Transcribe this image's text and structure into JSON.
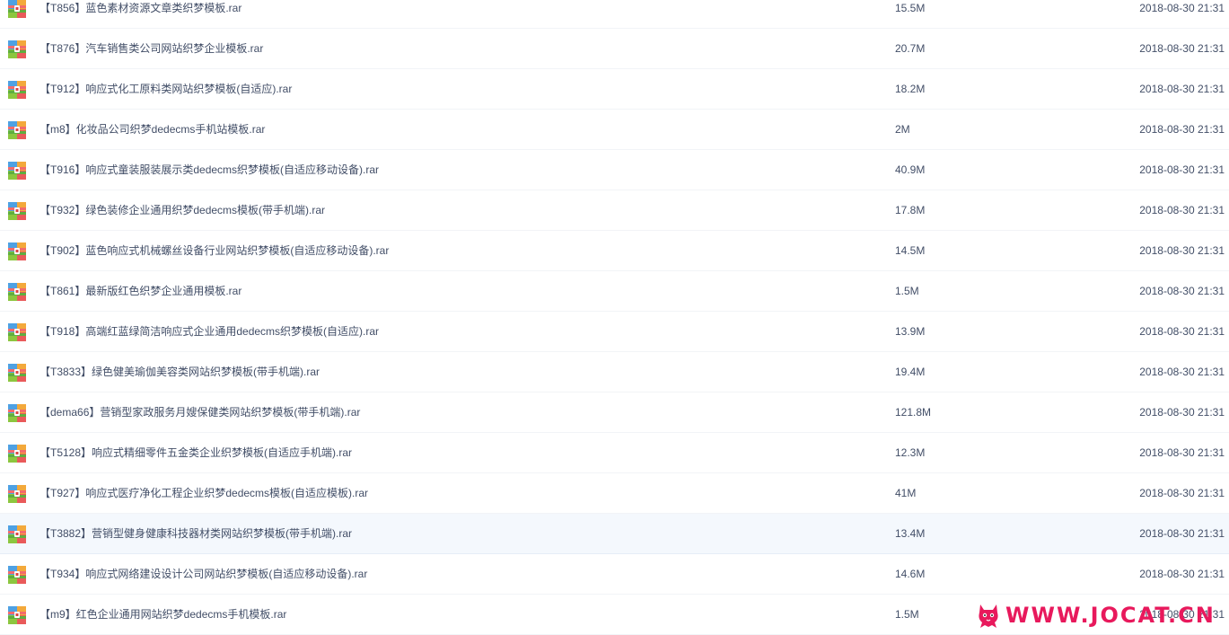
{
  "files": [
    {
      "name": "【T856】蓝色素材资源文章类织梦模板.rar",
      "size": "15.5M",
      "date": "2018-08-30 21:31"
    },
    {
      "name": "【T876】汽车销售类公司网站织梦企业模板.rar",
      "size": "20.7M",
      "date": "2018-08-30 21:31"
    },
    {
      "name": "【T912】响应式化工原料类网站织梦模板(自适应).rar",
      "size": "18.2M",
      "date": "2018-08-30 21:31"
    },
    {
      "name": "【m8】化妆品公司织梦dedecms手机站模板.rar",
      "size": "2M",
      "date": "2018-08-30 21:31"
    },
    {
      "name": "【T916】响应式童装服装展示类dedecms织梦模板(自适应移动设备).rar",
      "size": "40.9M",
      "date": "2018-08-30 21:31"
    },
    {
      "name": "【T932】绿色装修企业通用织梦dedecms模板(带手机端).rar",
      "size": "17.8M",
      "date": "2018-08-30 21:31"
    },
    {
      "name": "【T902】蓝色响应式机械螺丝设备行业网站织梦模板(自适应移动设备).rar",
      "size": "14.5M",
      "date": "2018-08-30 21:31"
    },
    {
      "name": "【T861】最新版红色织梦企业通用模板.rar",
      "size": "1.5M",
      "date": "2018-08-30 21:31"
    },
    {
      "name": "【T918】高端红蓝绿简洁响应式企业通用dedecms织梦模板(自适应).rar",
      "size": "13.9M",
      "date": "2018-08-30 21:31"
    },
    {
      "name": "【T3833】绿色健美瑜伽美容类网站织梦模板(带手机端).rar",
      "size": "19.4M",
      "date": "2018-08-30 21:31"
    },
    {
      "name": "【dema66】营销型家政服务月嫂保健类网站织梦模板(带手机端).rar",
      "size": "121.8M",
      "date": "2018-08-30 21:31"
    },
    {
      "name": "【T5128】响应式精细零件五金类企业织梦模板(自适应手机端).rar",
      "size": "12.3M",
      "date": "2018-08-30 21:31"
    },
    {
      "name": "【T927】响应式医疗净化工程企业织梦dedecms模板(自适应模板).rar",
      "size": "41M",
      "date": "2018-08-30 21:31"
    },
    {
      "name": "【T3882】营销型健身健康科技器材类网站织梦模板(带手机端).rar",
      "size": "13.4M",
      "date": "2018-08-30 21:31",
      "hovered": true
    },
    {
      "name": "【T934】响应式网络建设设计公司网站织梦模板(自适应移动设备).rar",
      "size": "14.6M",
      "date": "2018-08-30 21:31"
    },
    {
      "name": "【m9】红色企业通用网站织梦dedecms手机模板.rar",
      "size": "1.5M",
      "date": "2018-08-30 21:31"
    }
  ],
  "icons": {
    "file": "rar-archive-icon"
  },
  "colors": {
    "text": "#424e67",
    "row_divider": "#f2f4f7",
    "row_hover": "#f4f8fd",
    "watermark": "#e8195c"
  },
  "watermark": {
    "text": "WWW.JOCAT.CN"
  }
}
